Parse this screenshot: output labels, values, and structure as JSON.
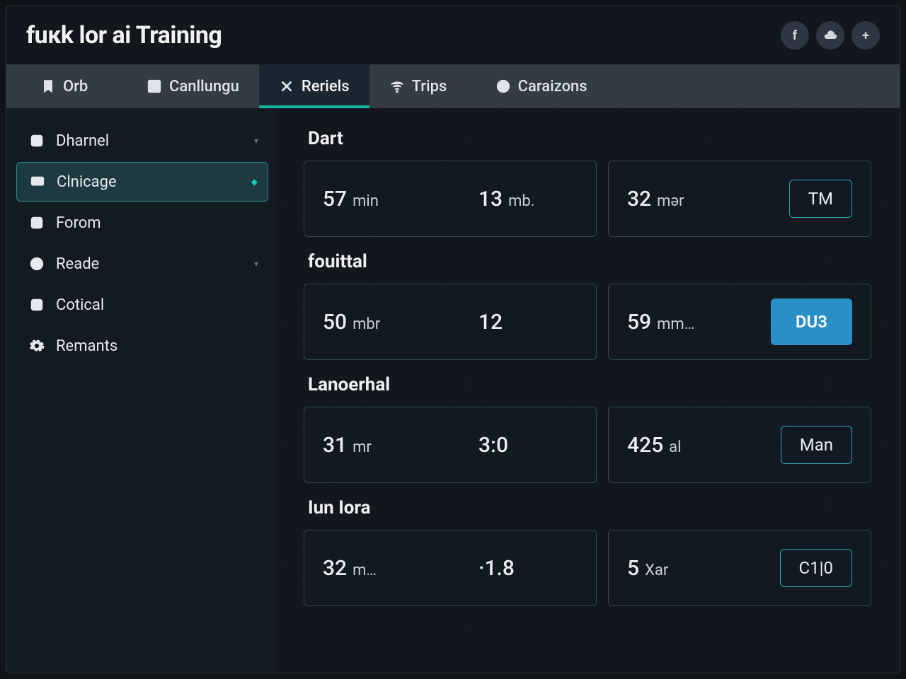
{
  "header": {
    "title": "fuкk lor аi Training",
    "actions": [
      {
        "name": "facebook-icon",
        "glyph": "f"
      },
      {
        "name": "cloud-icon",
        "glyph": "svg-cloud"
      },
      {
        "name": "plus-icon",
        "glyph": "+"
      }
    ]
  },
  "tabs": [
    {
      "name": "tab-orb",
      "label": "Orb",
      "icon": "bookmark-icon",
      "active": false
    },
    {
      "name": "tab-canllungu",
      "label": "Canllungu",
      "icon": "grid-icon",
      "active": false
    },
    {
      "name": "tab-reriels",
      "label": "Reriels",
      "icon": "close-icon",
      "active": true
    },
    {
      "name": "tab-trips",
      "label": "Trips",
      "icon": "wifi-icon",
      "active": false
    },
    {
      "name": "tab-caraizons",
      "label": "Caraizons",
      "icon": "target-icon",
      "active": false
    }
  ],
  "sidebar": {
    "items": [
      {
        "name": "sidebar-item-dharnel",
        "label": "Dharnel",
        "icon": "square-dot-icon",
        "expandable": true,
        "active": false
      },
      {
        "name": "sidebar-item-clnicage",
        "label": "Clnicage",
        "icon": "monitor-icon",
        "expandable": true,
        "active": true
      },
      {
        "name": "sidebar-item-forom",
        "label": "Forom",
        "icon": "checkbox-icon",
        "expandable": false,
        "active": false
      },
      {
        "name": "sidebar-item-reade",
        "label": "Reade",
        "icon": "info-icon",
        "expandable": true,
        "active": false
      },
      {
        "name": "sidebar-item-cotical",
        "label": "Cotical",
        "icon": "layout-icon",
        "expandable": false,
        "active": false
      },
      {
        "name": "sidebar-item-remants",
        "label": "Remants",
        "icon": "gear-icon",
        "expandable": false,
        "active": false
      }
    ]
  },
  "sections": [
    {
      "title": "Dart",
      "left": [
        {
          "val": "57",
          "unit": "mіn"
        },
        {
          "val": "13",
          "unit": "mb."
        }
      ],
      "right": {
        "val": "32",
        "unit": "mər"
      },
      "badge": {
        "label": "TM",
        "style": "outline"
      }
    },
    {
      "title": "fouittal",
      "left": [
        {
          "val": "50",
          "unit": "mbr"
        },
        {
          "val": "12",
          "unit": ""
        }
      ],
      "right": {
        "val": "59",
        "unit": "mm…"
      },
      "badge": {
        "label": "DU3",
        "style": "solid"
      }
    },
    {
      "title": "Lanoerhal",
      "left": [
        {
          "val": "31",
          "unit": "mr"
        },
        {
          "val": "3:0",
          "unit": ""
        }
      ],
      "right": {
        "val": "425",
        "unit": "al"
      },
      "badge": {
        "label": "Man",
        "style": "outline"
      }
    },
    {
      "title": "Iun Iora",
      "left": [
        {
          "val": "32",
          "unit": "m…"
        },
        {
          "val": "·1.8",
          "unit": ""
        }
      ],
      "right": {
        "val": "5",
        "unit": "Xar"
      },
      "badge": {
        "label": "C1|0",
        "style": "outline"
      }
    }
  ]
}
